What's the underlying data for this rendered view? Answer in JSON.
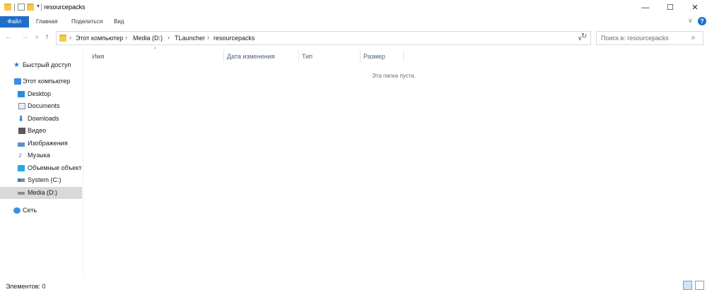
{
  "window": {
    "title": "resourcepacks",
    "minimize": "—",
    "maximize": "☐",
    "close": "✕"
  },
  "ribbon": {
    "tabs": [
      "Файл",
      "Главная",
      "Поделиться",
      "Вид"
    ],
    "help": "?"
  },
  "nav": {
    "back": "←",
    "forward": "→",
    "recent": "∨",
    "up": "↑"
  },
  "address": {
    "crumbs": [
      "Этот компьютер",
      "Media (D:)",
      "TLauncher",
      "resourcepacks"
    ],
    "separator": "›",
    "dropdown": "∨",
    "refresh": "↻"
  },
  "search": {
    "placeholder": "Поиск в: resourcepacks",
    "icon": "search-icon"
  },
  "sidebar": {
    "items": [
      {
        "label": "Быстрый доступ",
        "icon": "star-icon"
      },
      {
        "label": "Этот компьютер",
        "icon": "computer-icon"
      },
      {
        "label": "Desktop",
        "icon": "desktop-icon"
      },
      {
        "label": "Documents",
        "icon": "documents-icon"
      },
      {
        "label": "Downloads",
        "icon": "download-icon"
      },
      {
        "label": "Видео",
        "icon": "video-icon"
      },
      {
        "label": "Изображения",
        "icon": "pictures-icon"
      },
      {
        "label": "Музыка",
        "icon": "music-icon"
      },
      {
        "label": "Объемные объекты",
        "icon": "3d-objects-icon"
      },
      {
        "label": "System (C:)",
        "icon": "drive-icon"
      },
      {
        "label": "Media (D:)",
        "icon": "drive-icon",
        "selected": true
      },
      {
        "label": "Сеть",
        "icon": "network-icon"
      }
    ]
  },
  "columns": [
    "Имя",
    "Дата изменения",
    "Тип",
    "Размер"
  ],
  "content": {
    "empty_message": "Эта папка пуста."
  },
  "status": {
    "items": "Элементов: 0"
  },
  "colors": {
    "accent": "#1e6fc8",
    "folder": "#f5c84c",
    "selected": "#d9d9d9"
  }
}
